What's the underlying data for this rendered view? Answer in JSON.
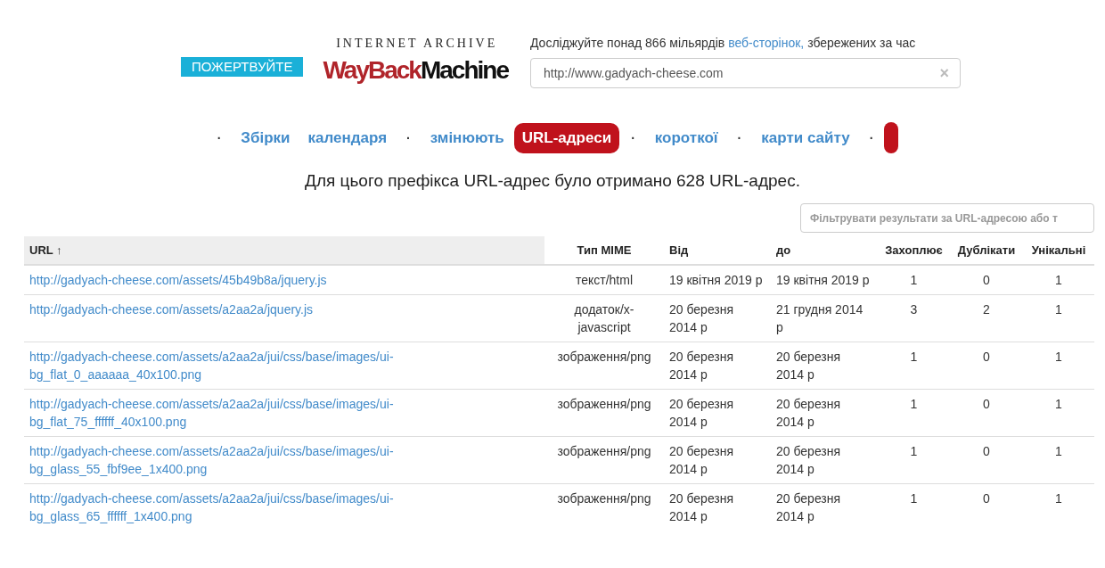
{
  "donate_button": "ПОЖЕРТВУЙТЕ",
  "logo": {
    "top": "INTERNET ARCHIVE",
    "wayback": "WayBack",
    "machine": "Machine"
  },
  "tagline": {
    "before": "Досліджуйте понад 866 мільярдів",
    "link": "веб-сторінок,",
    "after": "збережених за час"
  },
  "search": {
    "value": "http://www.gadyach-cheese.com",
    "clear": "×"
  },
  "nav": [
    {
      "kind": "link",
      "label": "Збірки",
      "dot": "·",
      "selected": false
    },
    {
      "kind": "link",
      "label": "календаря",
      "selected": false
    },
    {
      "kind": "link",
      "label": "змінюють",
      "dot": "·",
      "selected": false
    },
    {
      "kind": "link",
      "label": "URL-адреси",
      "selected": true
    },
    {
      "kind": "link",
      "label": "короткої",
      "dot": "·",
      "selected": false
    },
    {
      "kind": "link",
      "label": "карти сайту",
      "dot": "·",
      "selected": false
    },
    {
      "kind": "pill",
      "dot": "·",
      "selected": false
    }
  ],
  "summary": "Для цього префікса URL-адрес було отримано 628 URL-адрес.",
  "filter": {
    "placeholder": "Фільтрувати результати за URL-адресою або т"
  },
  "table": {
    "columns": [
      {
        "label": "URL ↑",
        "sorted": true
      },
      {
        "label": "Тип MIME",
        "sorted": false
      },
      {
        "label": "Від",
        "sorted": false
      },
      {
        "label": "до",
        "sorted": false
      },
      {
        "label": "Захоплює",
        "sorted": false
      },
      {
        "label": "Дублікати",
        "sorted": false
      },
      {
        "label": "Унікальні",
        "sorted": false
      }
    ],
    "rows": [
      [
        "http://gadyach-cheese.com/assets/45b49b8a/jquery.js",
        "текст/html",
        "19 квітня 2019 р",
        "19 квітня 2019 р",
        "1",
        "0",
        "1"
      ],
      [
        "http://gadyach-cheese.com/assets/a2aa2a/jquery.js",
        "додаток/x-javascript",
        "20 березня 2014 р",
        "21 грудня 2014 р",
        "3",
        "2",
        "1"
      ],
      [
        "http://gadyach-cheese.com/assets/a2aa2a/jui/css/base/images/ui-bg_flat_0_aaaaaa_40x100.png",
        "зображення/png",
        "20 березня 2014 р",
        "20 березня 2014 р",
        "1",
        "0",
        "1"
      ],
      [
        "http://gadyach-cheese.com/assets/a2aa2a/jui/css/base/images/ui-bg_flat_75_ffffff_40x100.png",
        "зображення/png",
        "20 березня 2014 р",
        "20 березня 2014 р",
        "1",
        "0",
        "1"
      ],
      [
        "http://gadyach-cheese.com/assets/a2aa2a/jui/css/base/images/ui-bg_glass_55_fbf9ee_1x400.png",
        "зображення/png",
        "20 березня 2014 р",
        "20 березня 2014 р",
        "1",
        "0",
        "1"
      ],
      [
        "http://gadyach-cheese.com/assets/a2aa2a/jui/css/base/images/ui-bg_glass_65_ffffff_1x400.png",
        "зображення/png",
        "20 березня 2014 р",
        "20 березня 2014 р",
        "1",
        "0",
        "1"
      ]
    ]
  }
}
